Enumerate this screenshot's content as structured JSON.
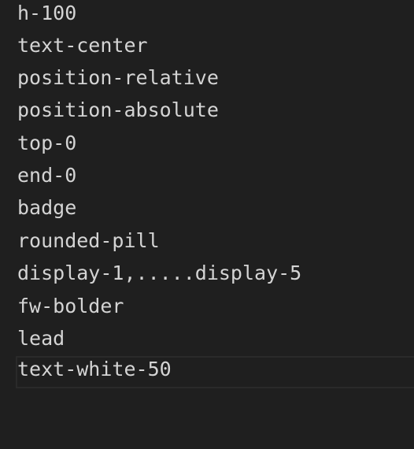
{
  "editor": {
    "lines": [
      "h-100",
      "text-center",
      "position-relative",
      "position-absolute",
      "top-0",
      "end-0",
      "badge",
      "rounded-pill",
      "display-1,.....display-5",
      "fw-bolder",
      "lead",
      "text-white-50"
    ],
    "current_line_index": 11
  }
}
